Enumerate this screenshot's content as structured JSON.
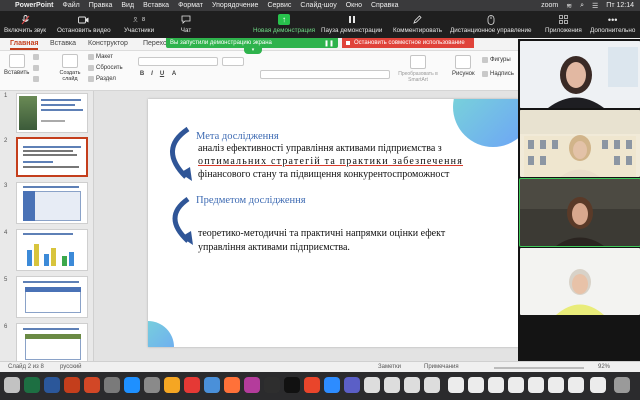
{
  "menubar": {
    "app": "PowerPoint",
    "items": [
      "Файл",
      "Правка",
      "Вид",
      "Вставка",
      "Формат",
      "Упорядочение",
      "Сервис",
      "Слайд-шоу",
      "Окно",
      "Справка"
    ],
    "zoom_label": "zoom",
    "clock": "Пт 12:14"
  },
  "zoombar": {
    "items": [
      {
        "label": "Включить звук",
        "icon": "mic-muted-icon"
      },
      {
        "label": "Остановить видео",
        "icon": "video-icon"
      },
      {
        "label": "Участники",
        "icon": "participants-icon",
        "count": "8"
      },
      {
        "label": "Чат",
        "icon": "chat-icon"
      },
      {
        "label": "Новая демонстрация",
        "icon": "share-screen-icon"
      },
      {
        "label": "Пауза демонстрации",
        "icon": "pause-icon"
      },
      {
        "label": "Комментировать",
        "icon": "annotate-icon"
      },
      {
        "label": "Дистанционное управление",
        "icon": "remote-control-icon"
      },
      {
        "label": "Приложения",
        "icon": "apps-icon"
      },
      {
        "label": "Дополнительно",
        "icon": "more-icon"
      }
    ],
    "share_banner": "Вы запустили демонстрацию экрана",
    "stop_share": "Остановить совместное использование"
  },
  "ribbon": {
    "tabs": [
      "Главная",
      "Вставка",
      "Конструктор",
      "Перехо"
    ],
    "insert_label": "Вставить",
    "new_slide_label": "Создать слайд",
    "layout_label": "Макет",
    "reset_label": "Сбросить",
    "section_label": "Раздел",
    "smartart_label": "Преобразовать в SmartArt",
    "picture_label": "Рисунок",
    "shapes_label": "Фигуры",
    "textbox_label": "Надпись"
  },
  "thumbnails": [
    {
      "num": "1",
      "title": "Презентація до наукової роботи"
    },
    {
      "num": "2",
      "title": "Мета дослідження"
    },
    {
      "num": "3",
      "title": "Таблиця"
    },
    {
      "num": "4",
      "title": "Діаграма"
    },
    {
      "num": "5",
      "title": "Таблиця"
    },
    {
      "num": "6",
      "title": "Таблиця"
    }
  ],
  "slide": {
    "heading1": "Мета дослідження",
    "text1_a": "аналіз ефективності управління активами підприємства з",
    "text1_b": "оптимальних стратегій та практики забезпечення",
    "text1_c": "фінансового стану та підвищення конкурентоспроможност",
    "heading2": "Предметом дослідження",
    "text2_a": "теоретико-методичні та практичні напрямки оцінки ефект",
    "text2_b": "управління активами підприємства."
  },
  "statusbar": {
    "slide_of": "Слайд 2 из 8",
    "language": "русский",
    "notes": "Заметки",
    "comments": "Примечания",
    "zoom": "92%"
  },
  "colors": {
    "ppt_accent": "#c43e1c",
    "slide_heading": "#3e6bb3",
    "zoom_green": "#2eb34c",
    "stop_red": "#e0433a"
  }
}
